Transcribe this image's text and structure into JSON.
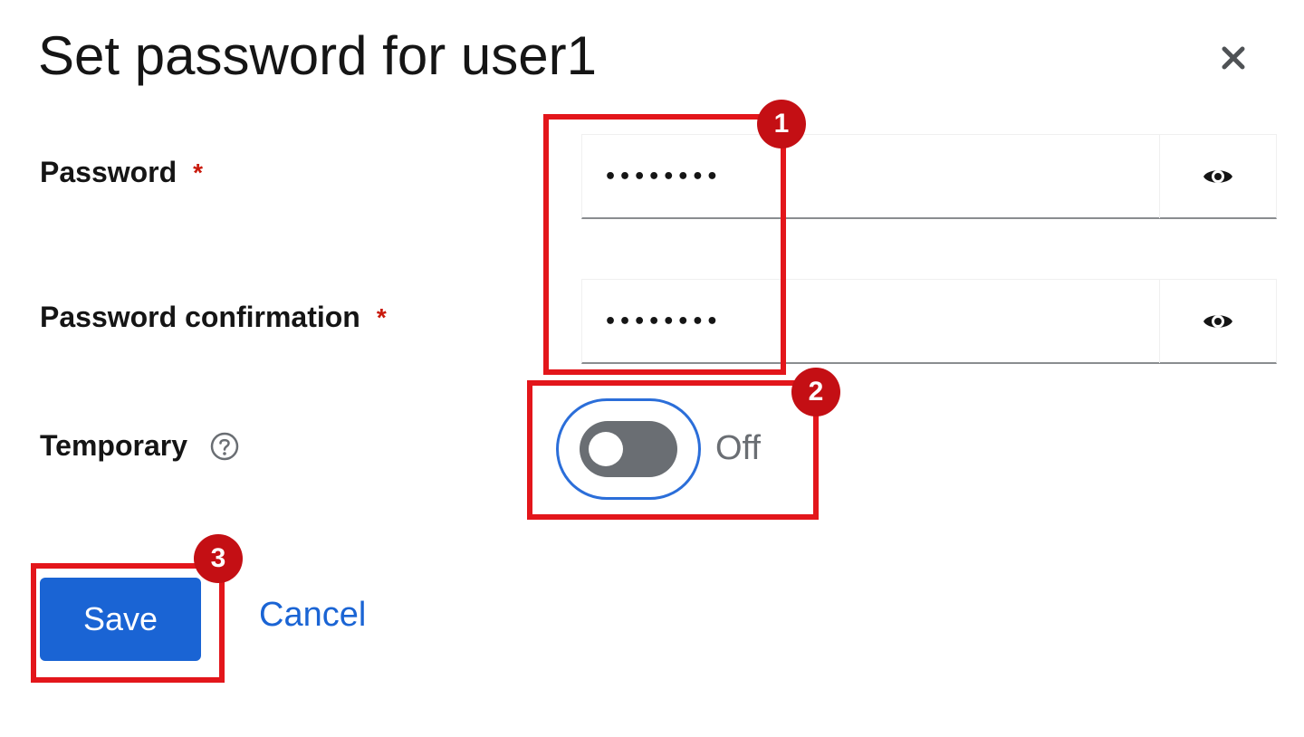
{
  "dialog": {
    "title": "Set password for user1",
    "close_icon": "close-icon"
  },
  "form": {
    "password": {
      "label": "Password",
      "required_mark": "*",
      "value": "password",
      "toggle_icon": "eye-icon"
    },
    "password_confirmation": {
      "label": "Password confirmation",
      "required_mark": "*",
      "value": "password",
      "toggle_icon": "eye-icon"
    },
    "temporary": {
      "label": "Temporary",
      "help_icon": "help-icon",
      "state": "Off",
      "checked": false
    }
  },
  "actions": {
    "save_label": "Save",
    "cancel_label": "Cancel"
  },
  "annotations": {
    "badges": [
      "1",
      "2",
      "3"
    ],
    "color": "#e3161b"
  },
  "colors": {
    "primary": "#1a64d4",
    "focus_ring": "#2b6ed9",
    "required": "#c9190b",
    "toggle_off": "#6a6e73"
  }
}
